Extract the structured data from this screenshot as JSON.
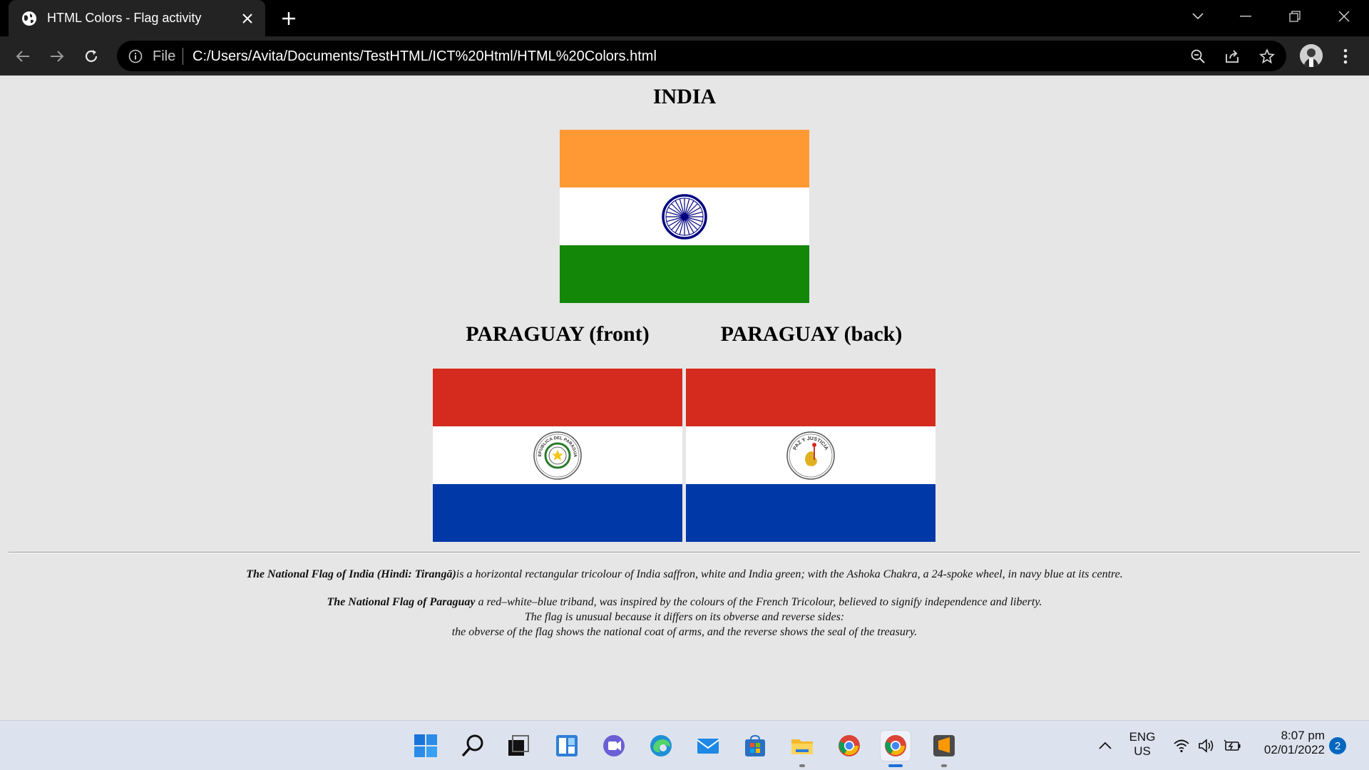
{
  "browser": {
    "tab_title": "HTML Colors - Flag activity",
    "url_scheme_label": "File",
    "url": "C:/Users/Avita/Documents/TestHTML/ICT%20Html/HTML%20Colors.html"
  },
  "page": {
    "india_heading": "INDIA",
    "paraguay_front_heading": "PARAGUAY (front)",
    "paraguay_back_heading": "PARAGUAY (back)",
    "india_desc_bold": "The National Flag of India (Hindi: Tirangā)",
    "india_desc_rest": "is a horizontal rectangular tricolour of India saffron, white and India green; with the Ashoka Chakra, a 24-spoke wheel, in navy blue at its centre.",
    "paraguay_desc_bold": "The National Flag of Paraguay",
    "paraguay_desc_line1": " a red–white–blue triband, was inspired by the colours of the French Tricolour, believed to signify independence and liberty.",
    "paraguay_desc_line2": "The flag is unusual because it differs on its obverse and reverse sides:",
    "paraguay_desc_line3": "the obverse of the flag shows the national coat of arms, and the reverse shows the seal of the treasury.",
    "seal_front_text": "REPUBLICA DEL PARAGUAY",
    "seal_back_text": "PAZ Y JUSTICIA"
  },
  "colors": {
    "india_saffron": "#FF9933",
    "india_white": "#FFFFFF",
    "india_green": "#138808",
    "chakra_navy": "#000080",
    "paraguay_red": "#D52B1E",
    "paraguay_white": "#FFFFFF",
    "paraguay_blue": "#0038A8"
  },
  "taskbar": {
    "apps": [
      "windows-start-icon",
      "search-icon",
      "task-view-icon",
      "widgets-icon",
      "teams-chat-icon",
      "edge-icon",
      "mail-icon",
      "store-icon",
      "file-explorer-icon",
      "chrome-icon",
      "chrome-icon",
      "sublime-text-icon"
    ],
    "lang_line1": "ENG",
    "lang_line2": "US",
    "time": "8:07 pm",
    "date": "02/01/2022",
    "notification_count": "2"
  }
}
